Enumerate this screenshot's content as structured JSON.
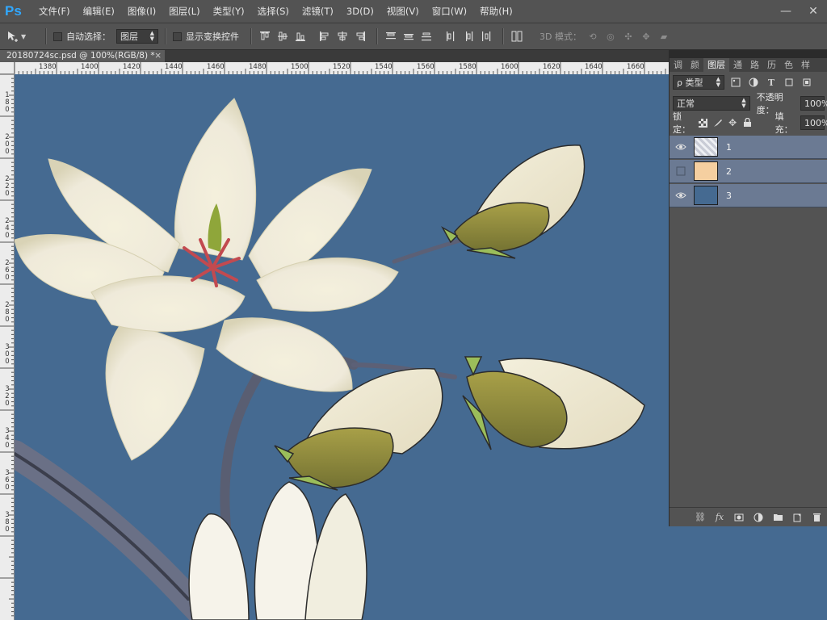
{
  "app": {
    "logo": "Ps"
  },
  "menu": [
    "文件(F)",
    "编辑(E)",
    "图像(I)",
    "图层(L)",
    "类型(Y)",
    "选择(S)",
    "滤镜(T)",
    "3D(D)",
    "视图(V)",
    "窗口(W)",
    "帮助(H)"
  ],
  "window_controls": {
    "minimize": "—",
    "close": "✕"
  },
  "options": {
    "auto_select_label": "自动选择：",
    "auto_select_target": "图层",
    "show_transform_label": "显示变换控件",
    "mode_3d_label": "3D 模式："
  },
  "document_tab": {
    "title": "20180724sc.psd @ 100%(RGB/8) *",
    "close": "×"
  },
  "ruler_h": [
    "1380",
    "1400",
    "1420",
    "1440",
    "1460",
    "1480",
    "1500",
    "1520",
    "1540",
    "1560",
    "1580",
    "1600",
    "1620",
    "1640",
    "1660"
  ],
  "ruler_v": [
    "180",
    "200",
    "220",
    "240",
    "260",
    "280",
    "300",
    "320",
    "340",
    "360",
    "380"
  ],
  "panel": {
    "tabs": [
      "调",
      "颜",
      "图层",
      "通",
      "路",
      "历",
      "色",
      "样"
    ],
    "active_tab": "图层",
    "filter_label": "ρ 类型",
    "blend_mode": "正常",
    "opacity_label": "不透明度：",
    "opacity_value": "100%",
    "lock_label": "锁定：",
    "fill_label": "填充：",
    "fill_value": "100%",
    "layers": [
      {
        "name": "1",
        "visible": true,
        "thumb": "pattern"
      },
      {
        "name": "2",
        "visible": false,
        "thumb": "#f5cfa0"
      },
      {
        "name": "3",
        "visible": true,
        "thumb": "#456a91"
      }
    ]
  },
  "colors": {
    "canvas": "#456a91",
    "selected_layer": "#6b7a93",
    "accent": "#31a8ff"
  }
}
